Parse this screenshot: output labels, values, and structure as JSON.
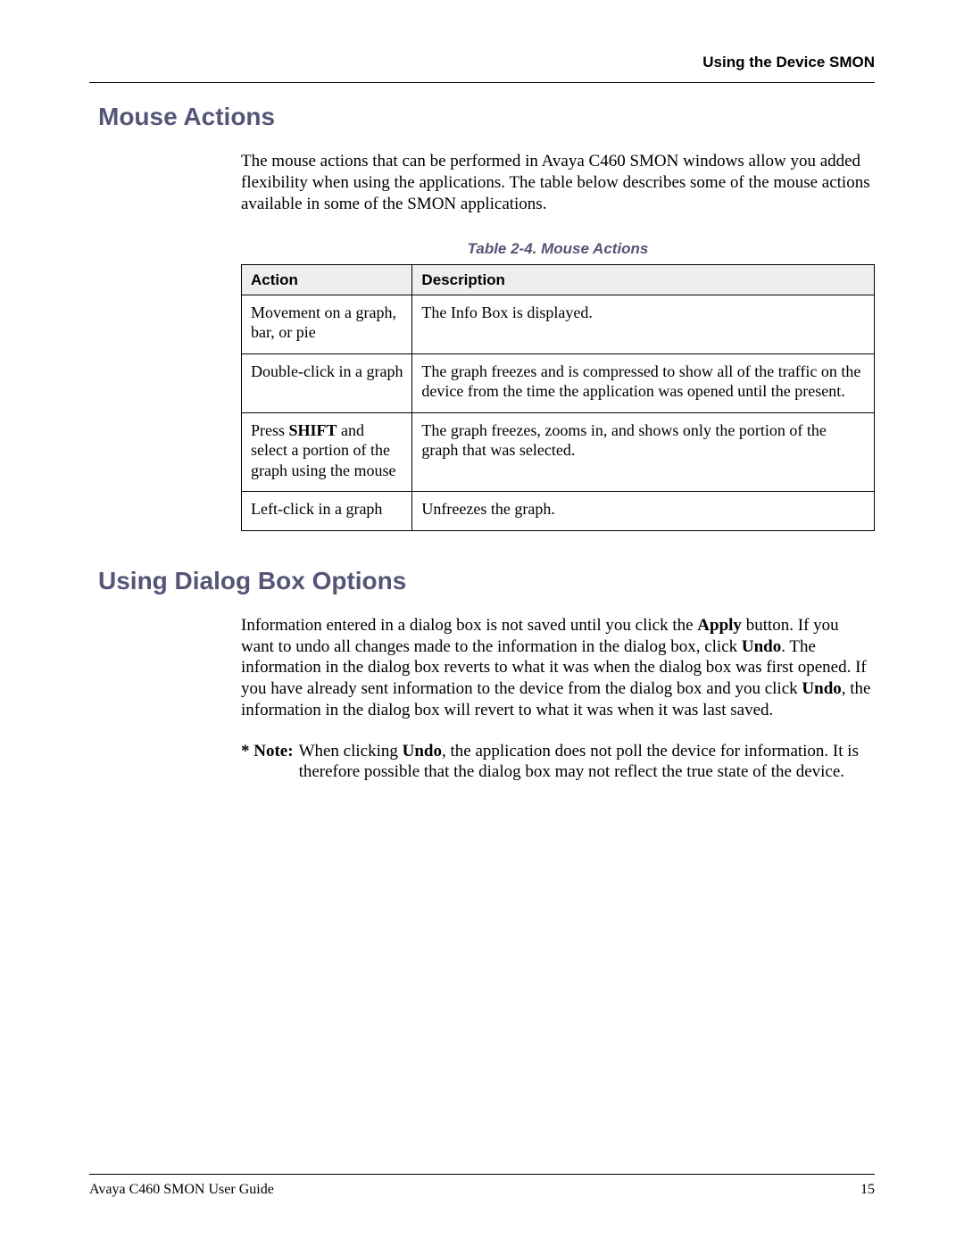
{
  "running_head": "Using the Device SMON",
  "section1": {
    "title": "Mouse Actions",
    "intro": "The mouse actions that can be performed in Avaya C460 SMON windows allow you added flexibility when using the applications. The table below describes some of the mouse actions available in some of the SMON applications.",
    "table_caption": "Table 2-4.  Mouse Actions",
    "table": {
      "headers": {
        "col1": "Action",
        "col2": "Description"
      },
      "rows": [
        {
          "action_plain": "Movement on a graph, bar, or pie",
          "description": "The Info Box is displayed."
        },
        {
          "action_plain": "Double-click in a graph",
          "description": "The graph freezes and is compressed to show all of the traffic on the device from the time the application was opened until the present."
        },
        {
          "action_pre": "Press ",
          "action_bold": "SHIFT",
          "action_post": " and select a portion of the graph using the mouse",
          "description": "The graph freezes, zooms in, and shows only the portion of the graph that was selected."
        },
        {
          "action_plain": "Left-click in a graph",
          "description": "Unfreezes the graph."
        }
      ]
    }
  },
  "section2": {
    "title": "Using Dialog Box Options",
    "para": {
      "p1": "Information entered in a dialog box is not saved until you click the ",
      "b1": "Apply",
      "p2": " button. If you want to undo all changes made to the information in the dialog box, click ",
      "b2": "Undo",
      "p3": ". The information in the dialog box reverts to what it was when the dialog box was first opened. If you have already sent information to the device from the dialog box and you click ",
      "b3": "Undo",
      "p4": ", the information in the dialog box will revert to what it was when it was last saved."
    },
    "note": {
      "label": "* Note:",
      "t1": "When clicking ",
      "b1": "Undo",
      "t2": ", the application does not poll the device for information. It is therefore possible that the dialog box may not reflect the true state of the device."
    }
  },
  "footer": {
    "doc_title": "Avaya C460 SMON User Guide",
    "page_number": "15"
  }
}
